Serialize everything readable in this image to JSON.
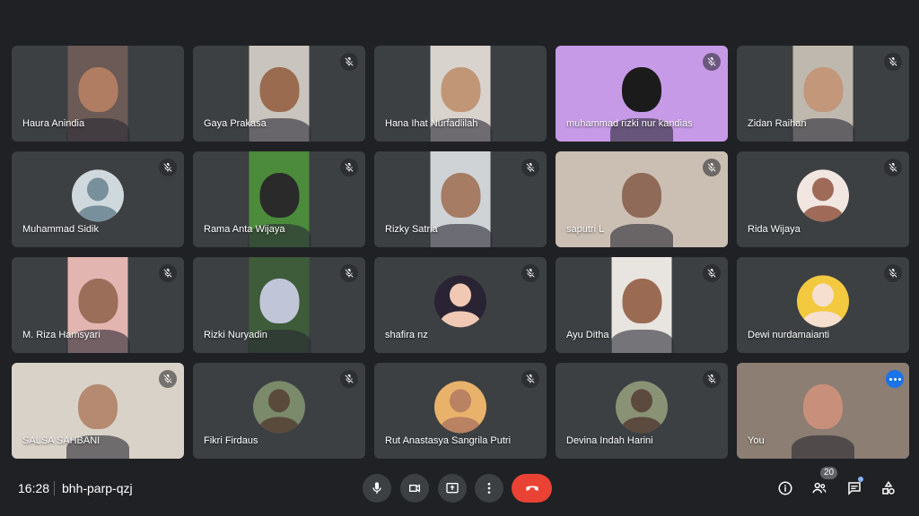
{
  "meeting": {
    "time": "16:28",
    "code": "bhh-parp-qzj"
  },
  "participants": [
    {
      "name": "Haura Anindia",
      "muted": false,
      "kind": "video-center",
      "bg": "#6b5a55",
      "skin": "#b07d62"
    },
    {
      "name": "Gaya Prakasa",
      "muted": true,
      "kind": "video-center",
      "bg": "#c9c4bd",
      "skin": "#9a6b4f"
    },
    {
      "name": "Hana Ihat Nurfadlilah",
      "muted": false,
      "kind": "video-center",
      "bg": "#d8d3cc",
      "skin": "#c19677"
    },
    {
      "name": "muhammad rizki nur kandias",
      "muted": true,
      "kind": "video-full",
      "bg": "#c79ae8",
      "skin": "#1b1b1b"
    },
    {
      "name": "Zidan Raihan",
      "muted": true,
      "kind": "video-center",
      "bg": "#bfb8ae",
      "skin": "#c2977a"
    },
    {
      "name": "Muhammad Sidik",
      "muted": true,
      "kind": "avatar",
      "bg": "#cfd8dc",
      "skin": "#78909c"
    },
    {
      "name": "Rama Anta Wijaya",
      "muted": true,
      "kind": "video-center",
      "bg": "#4c8a3c",
      "skin": "#2a2a2a"
    },
    {
      "name": "Rizky Satria",
      "muted": true,
      "kind": "video-center",
      "bg": "#cfd3d6",
      "skin": "#a67c64"
    },
    {
      "name": "saputri L",
      "muted": true,
      "kind": "video-full",
      "bg": "#cbbfb3",
      "skin": "#8f6a58"
    },
    {
      "name": "Rida Wijaya",
      "muted": true,
      "kind": "avatar",
      "bg": "#f2e6e0",
      "skin": "#a06a58"
    },
    {
      "name": "M. Riza Hamsyari",
      "muted": true,
      "kind": "video-center",
      "bg": "#e3b5b0",
      "skin": "#9b6e5a"
    },
    {
      "name": "Rizki Nuryadin",
      "muted": true,
      "kind": "video-center",
      "bg": "#3e5c3a",
      "skin": "#c0c6d8"
    },
    {
      "name": "shafira nz",
      "muted": true,
      "kind": "avatar",
      "bg": "#2a2333",
      "skin": "#f0c8b4"
    },
    {
      "name": "Ayu Ditha",
      "muted": true,
      "kind": "video-center",
      "bg": "#e8e5e0",
      "skin": "#9a6b52"
    },
    {
      "name": "Dewi nurdamaianti",
      "muted": true,
      "kind": "avatar",
      "bg": "#f3c940",
      "skin": "#f7dfd0"
    },
    {
      "name": "SALSA SAHBANI",
      "muted": true,
      "kind": "video-full",
      "bg": "#d9d2c8",
      "skin": "#b58a70"
    },
    {
      "name": "Fikri Firdaus",
      "muted": true,
      "kind": "avatar",
      "bg": "#7a8a6a",
      "skin": "#5a4a3c"
    },
    {
      "name": "Rut Anastasya Sangrila Putri",
      "muted": true,
      "kind": "avatar",
      "bg": "#e9b26b",
      "skin": "#b98262"
    },
    {
      "name": "Devina Indah Harini",
      "muted": true,
      "kind": "avatar",
      "bg": "#8a9276",
      "skin": "#5c4a3e"
    },
    {
      "name": "You",
      "muted": false,
      "kind": "video-full",
      "bg": "#8c7e72",
      "skin": "#c88f7a",
      "self": true
    }
  ],
  "controls": {
    "leave_label": "Leave call"
  },
  "people_count": "20",
  "colors": {
    "accent": "#8ab4f8",
    "leave": "#ea4335",
    "tile": "#3c4043",
    "background": "#202124"
  },
  "icons": [
    "mic-icon",
    "camera-icon",
    "present-icon",
    "more-options-icon",
    "end-call-icon",
    "info-icon",
    "people-icon",
    "chat-icon",
    "activities-icon",
    "mic-off-icon"
  ]
}
